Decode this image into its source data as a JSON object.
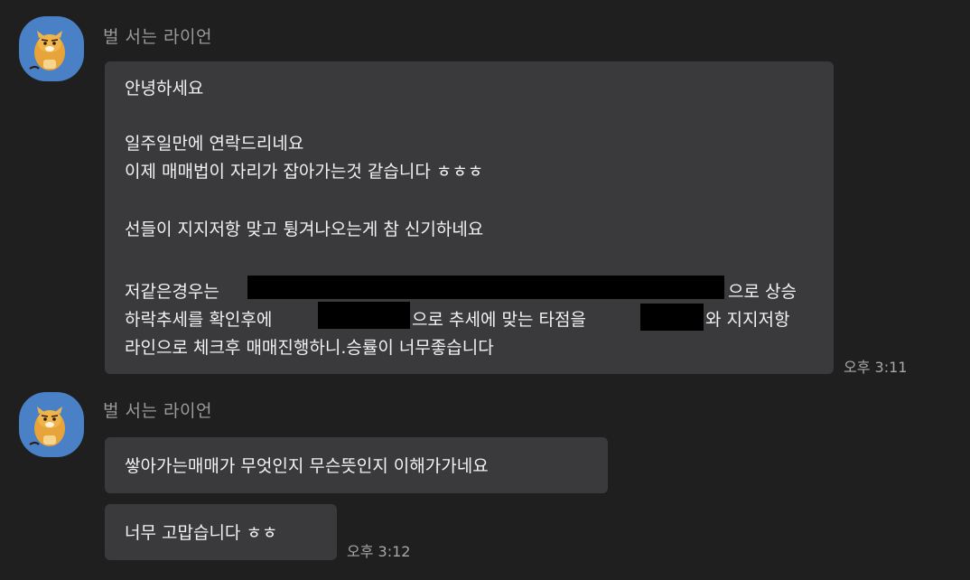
{
  "messages": [
    {
      "sender": "벌 서는 라이언",
      "avatar_icon": "lion-character-icon",
      "time": "오후 3:11",
      "lines": [
        "안녕하세요",
        "일주일만에 연락드리네요",
        "이제 매매법이 자리가 잡아가는것 같습니다 ㅎㅎㅎ",
        "선들이 지지저항 맞고 튕겨나오는게 참 신기하네요",
        "저같은경우는",
        "으로 상승",
        "하락추세를 확인후에",
        "으로 추세에 맞는 타점을",
        "와 지지저항",
        "라인으로 체크후 매매진행하니.승률이 너무좋습니다"
      ]
    },
    {
      "sender": "벌 서는 라이언",
      "avatar_icon": "lion-character-icon",
      "time": "오후 3:12",
      "bubbles": [
        "쌓아가는매매가 무엇인지 무슨뜻인지 이해가가네요",
        "너무 고맙습니다 ㅎㅎ"
      ]
    }
  ],
  "colors": {
    "background": "#1f1f1f",
    "bubble": "#3a3a3c",
    "avatar_bg": "#4a80c6",
    "sender_text": "#9a9a9a",
    "message_text": "#f2f2f2",
    "timestamp_text": "#a8a8a8"
  }
}
